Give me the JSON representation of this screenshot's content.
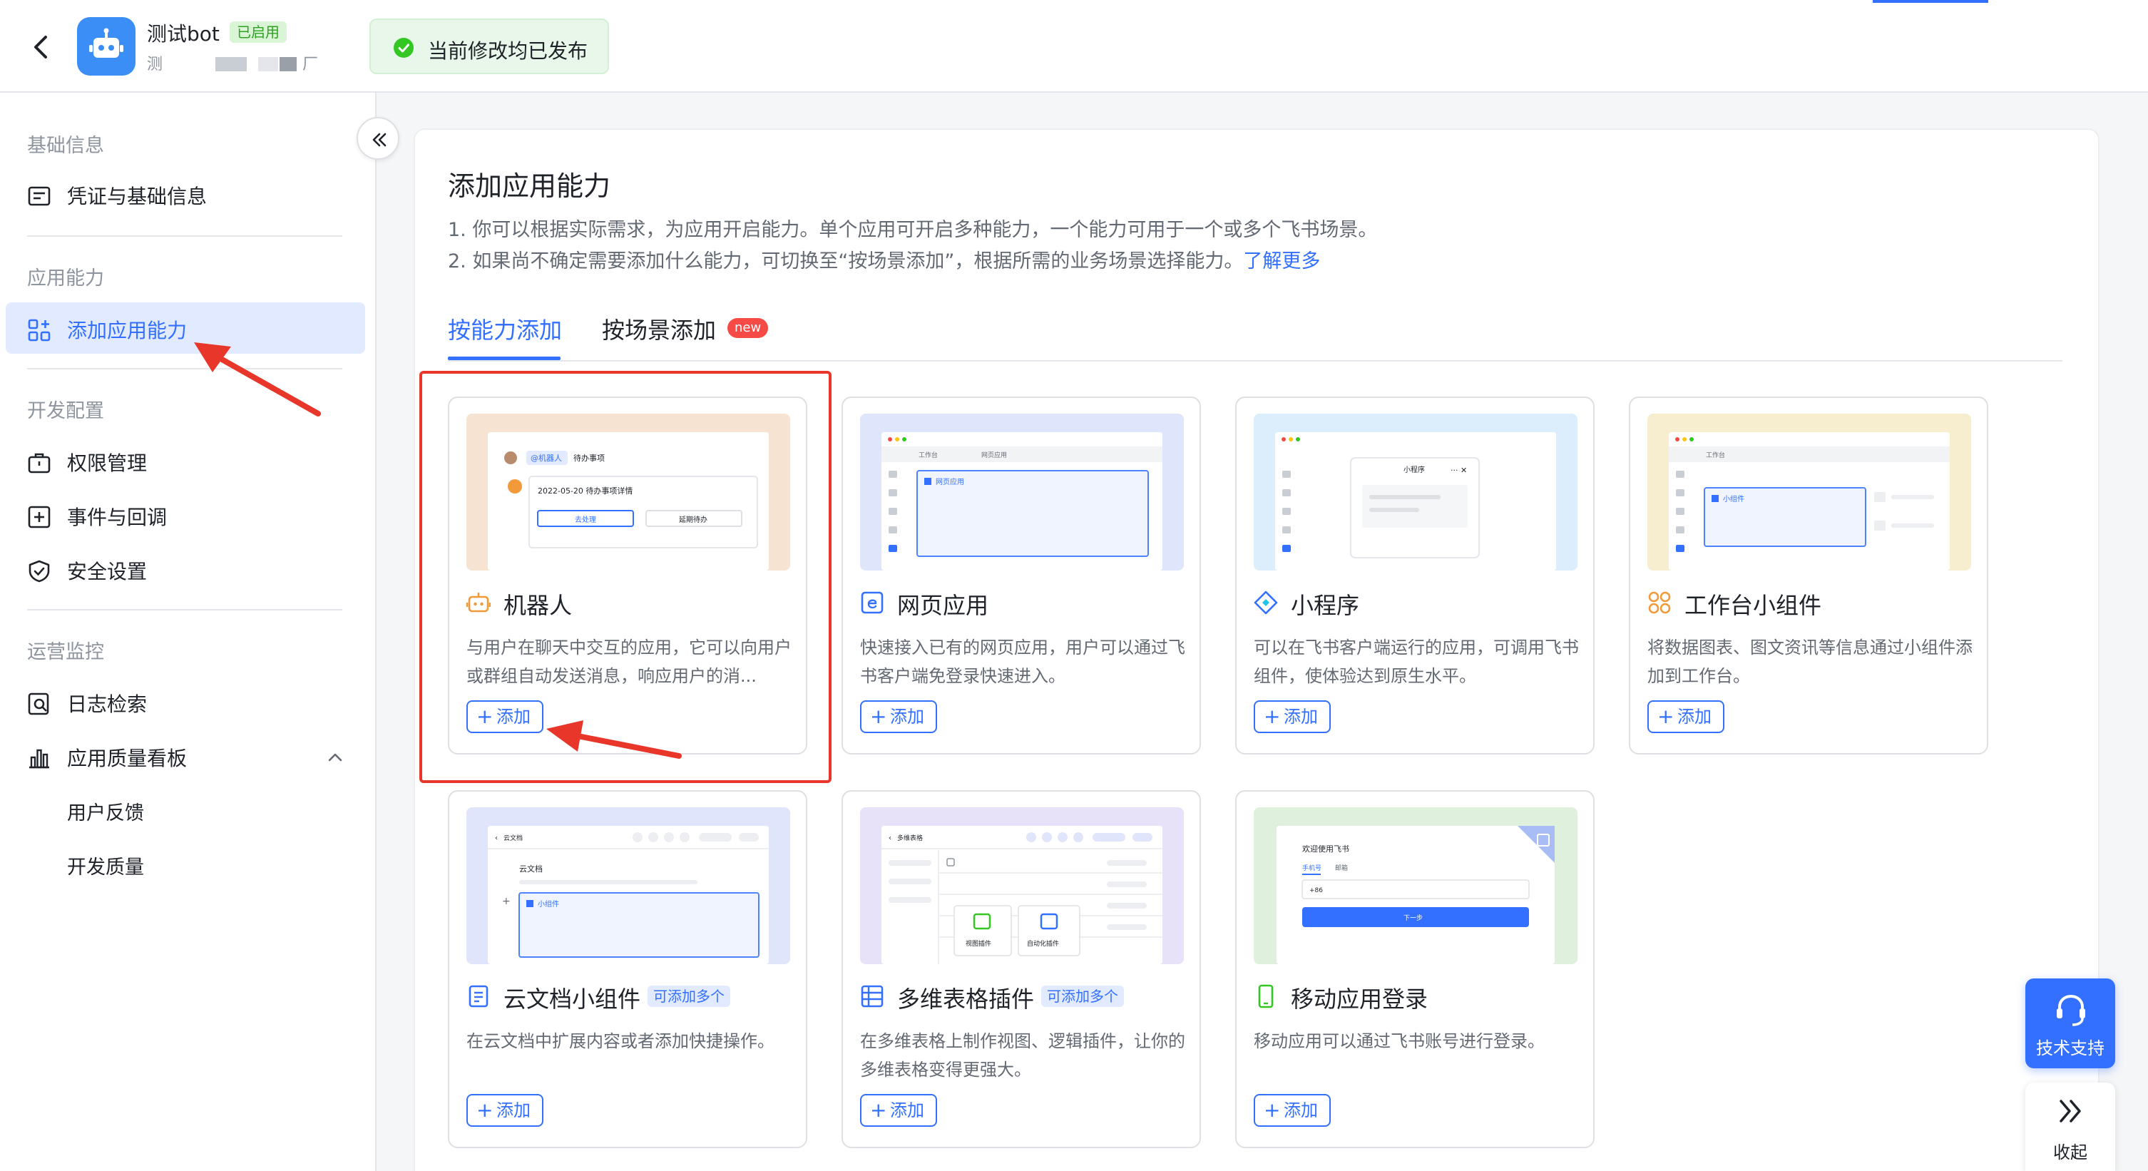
{
  "header": {
    "app_name": "测试bot",
    "app_status": "已启用",
    "app_sub_left": "测",
    "app_sub_right": "厂",
    "publish_status": "当前修改均已发布"
  },
  "sidebar": {
    "groups": [
      {
        "title": "基础信息",
        "items": [
          {
            "label": "凭证与基础信息"
          }
        ]
      },
      {
        "title": "应用能力",
        "items": [
          {
            "label": "添加应用能力"
          }
        ]
      },
      {
        "title": "开发配置",
        "items": [
          {
            "label": "权限管理"
          },
          {
            "label": "事件与回调"
          },
          {
            "label": "安全设置"
          }
        ]
      },
      {
        "title": "运营监控",
        "items": [
          {
            "label": "日志检索"
          },
          {
            "label": "应用质量看板"
          }
        ],
        "subitems": [
          {
            "label": "用户反馈"
          },
          {
            "label": "开发质量"
          }
        ]
      }
    ]
  },
  "main": {
    "title": "添加应用能力",
    "desc1": "1. 你可以根据实际需求，为应用开启能力。单个应用可开启多种能力，一个能力可用于一个或多个飞书场景。",
    "desc2": "2. 如果尚不确定需要添加什么能力，可切换至“按场景添加”，根据所需的业务场景选择能力。",
    "learn_more": "了解更多",
    "tabs": [
      {
        "label": "按能力添加"
      },
      {
        "label": "按场景添加"
      }
    ],
    "new_badge": "new",
    "add_label": "添加",
    "multi_label": "可添加多个",
    "cards": [
      {
        "title": "机器人",
        "desc": "与用户在聊天中交互的应用，它可以向用户或群组自动发送消息，响应用户的消...",
        "preview_bg": "#f6e3d1"
      },
      {
        "title": "网页应用",
        "desc": "快速接入已有的网页应用，用户可以通过飞书客户端免登录快速进入。",
        "preview_bg": "#dfe6fb"
      },
      {
        "title": "小程序",
        "desc": "可以在飞书客户端运行的应用，可调用飞书组件，使体验达到原生水平。",
        "preview_bg": "#dceefb"
      },
      {
        "title": "工作台小组件",
        "desc": "将数据图表、图文资讯等信息通过小组件添加到工作台。",
        "preview_bg": "#f7edcf"
      },
      {
        "title": "云文档小组件",
        "desc": "在云文档中扩展内容或者添加快捷操作。",
        "preview_bg": "#e1e5fb"
      },
      {
        "title": "多维表格插件",
        "desc": "在多维表格上制作视图、逻辑插件，让你的多维表格变得更强大。",
        "preview_bg": "#e8e2f8"
      },
      {
        "title": "移动应用登录",
        "desc": "移动应用可以通过飞书账号进行登录。",
        "preview_bg": "#dff1dc"
      }
    ],
    "previews": {
      "bot_at": "@机器人",
      "bot_todo": "待办事项",
      "bot_detail": "2022-05-20 待办事项详情",
      "bot_btn1": "去处理",
      "bot_btn2": "延期待办",
      "web_tab1": "工作台",
      "web_tab2": "网页应用",
      "web_label": "网页应用",
      "mini_title": "小程序",
      "wb_tab": "工作台",
      "wb_label": "小组件",
      "doc_title": "云文档",
      "doc_label": "小组件",
      "bitable_title": "多维表格",
      "bitable_view": "视图插件",
      "bitable_auto": "自动化插件",
      "login_title": "欢迎使用飞书",
      "login_tab1": "手机号",
      "login_tab2": "邮箱",
      "login_code": "+86",
      "login_next": "下一步"
    }
  },
  "floating": {
    "support": "技术支持",
    "fold": "收起"
  },
  "colors": {
    "accent": "#3370ff",
    "annotation_red": "#e8362a",
    "success": "#2ea121"
  }
}
